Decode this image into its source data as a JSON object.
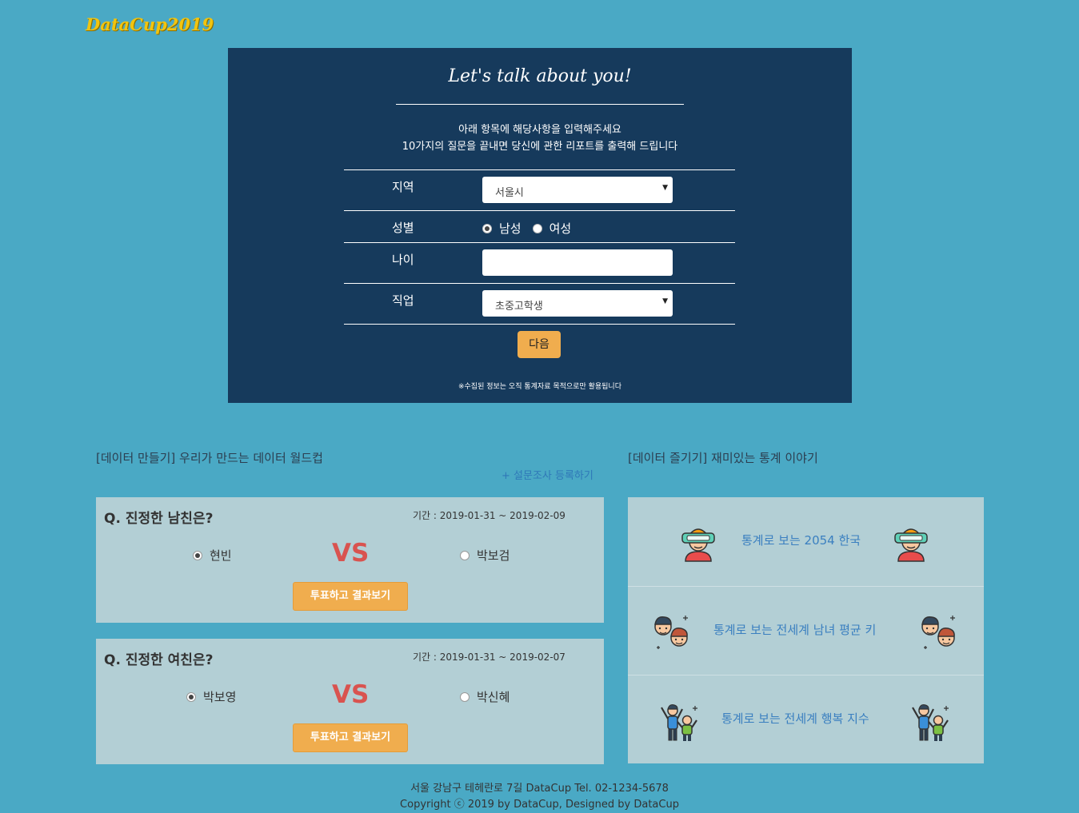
{
  "brand": {
    "logo_text": "DataCup2019"
  },
  "form": {
    "title": "Let's talk about you!",
    "desc_line1": "아래 항목에 해당사항을 입력해주세요",
    "desc_line2": "10가지의 질문을 끝내면 당신에 관한 리포트를 출력해 드립니다",
    "region": {
      "label": "지역",
      "value": "서울시"
    },
    "gender": {
      "label": "성별",
      "options": [
        "남성",
        "여성"
      ],
      "selected": "남성"
    },
    "age": {
      "label": "나이",
      "value": ""
    },
    "job": {
      "label": "직업",
      "value": "초중고학생"
    },
    "next_button": "다음",
    "note": "※수집된 정보는 오직 통계자료 목적으로만 활용됩니다"
  },
  "worldcup": {
    "title": "[데이터 만들기] 우리가 만드는 데이터 월드컵",
    "add_link": "+ 설문조사 등록하기",
    "polls": [
      {
        "question": "Q. 진정한 남친은?",
        "period": "기간 : 2019-01-31 ~ 2019-02-09",
        "left": "현빈",
        "right": "박보검",
        "selected": "left",
        "vs": "VS",
        "button": "투표하고 결과보기"
      },
      {
        "question": "Q. 진정한 여친은?",
        "period": "기간 : 2019-01-31 ~ 2019-02-07",
        "left": "박보영",
        "right": "박신혜",
        "selected": "left",
        "vs": "VS",
        "button": "투표하고 결과보기"
      }
    ]
  },
  "stories": {
    "title": "[데이터 즐기기] 재미있는 통계 이야기",
    "items": [
      {
        "label": "통계로 보는 2054 한국",
        "icon": "vr-headset-person-icon"
      },
      {
        "label": "통계로 보는 전세계 남녀 평균 키",
        "icon": "couple-faces-icon"
      },
      {
        "label": "통계로 보는 전세계 행복 지수",
        "icon": "cheering-group-icon"
      }
    ]
  },
  "footer": {
    "line1": "서울 강남구 테헤란로 7길 DataCup Tel. 02-1234-5678",
    "line2": "Copyright ⓒ 2019 by DataCup, Designed by DataCup"
  },
  "colors": {
    "background": "#4aa9c5",
    "panel": "#163a5c",
    "accent": "#f0ad4e",
    "vs": "#d9534f",
    "card": "#b3cfd5",
    "link": "#3a7fc0"
  }
}
